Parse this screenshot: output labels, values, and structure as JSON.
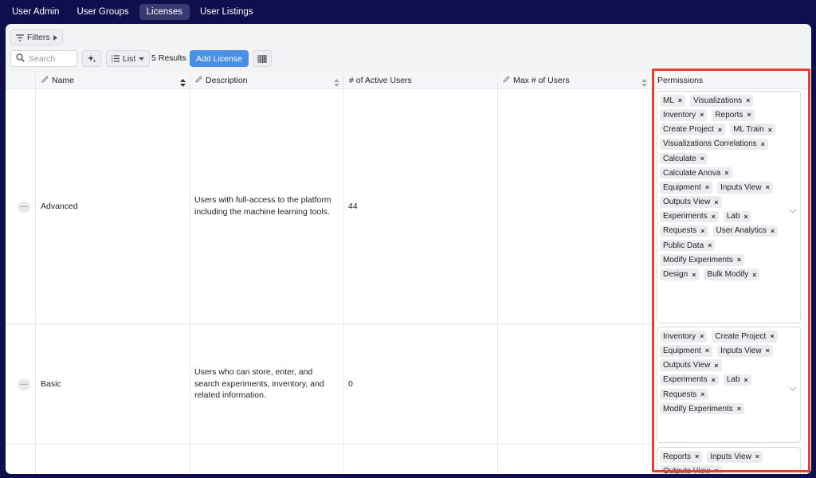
{
  "nav": {
    "tabs": [
      {
        "label": "User Admin",
        "active": false
      },
      {
        "label": "User Groups",
        "active": false
      },
      {
        "label": "Licenses",
        "active": true
      },
      {
        "label": "User Listings",
        "active": false
      }
    ]
  },
  "toolbar": {
    "filters_label": "Filters",
    "search_placeholder": "Search",
    "view_label": "List",
    "results": "5 Results",
    "add_label": "Add License"
  },
  "table": {
    "columns": {
      "name": "Name",
      "description": "Description",
      "active_users": "# of Active Users",
      "max_users": "Max # of Users",
      "permissions": "Permissions"
    },
    "rows": [
      {
        "name": "Advanced",
        "description": "Users with full-access to the platform including the machine learning tools.",
        "active_users": "44",
        "max_users": "",
        "permissions": [
          "ML",
          "Visualizations",
          "Inventory",
          "Reports",
          "Create Project",
          "ML Train",
          "Visualizations Correlations",
          "Calculate",
          "Calculate Anova",
          "Equipment",
          "Inputs View",
          "Outputs View",
          "Experiments",
          "Lab",
          "Requests",
          "User Analytics",
          "Public Data",
          "Modify Experiments",
          "Design",
          "Bulk Modify"
        ]
      },
      {
        "name": "Basic",
        "description": "Users who can store, enter, and search experiments, inventory, and related information.",
        "active_users": "0",
        "max_users": "",
        "permissions": [
          "Inventory",
          "Create Project",
          "Equipment",
          "Inputs View",
          "Outputs View",
          "Experiments",
          "Lab",
          "Requests",
          "Modify Experiments"
        ]
      },
      {
        "name": "",
        "description": "",
        "active_users": "",
        "max_users": "",
        "permissions": [
          "Reports",
          "Inputs View",
          "Outputs View"
        ]
      }
    ]
  },
  "colors": {
    "nav_bg": "#0f0f4d",
    "accent": "#4a8fe6",
    "highlight": "#e8402c"
  },
  "icons": {
    "filter": "filter-lines-icon",
    "search": "magnifier-icon",
    "magic": "sparkle-icon",
    "list": "list-lines-icon",
    "barcode": "barcode-icon",
    "edit": "pencil-icon",
    "sort": "sort-arrows-icon",
    "remove": "x-icon",
    "more": "ellipsis-icon",
    "expand": "chevron-down-icon"
  }
}
